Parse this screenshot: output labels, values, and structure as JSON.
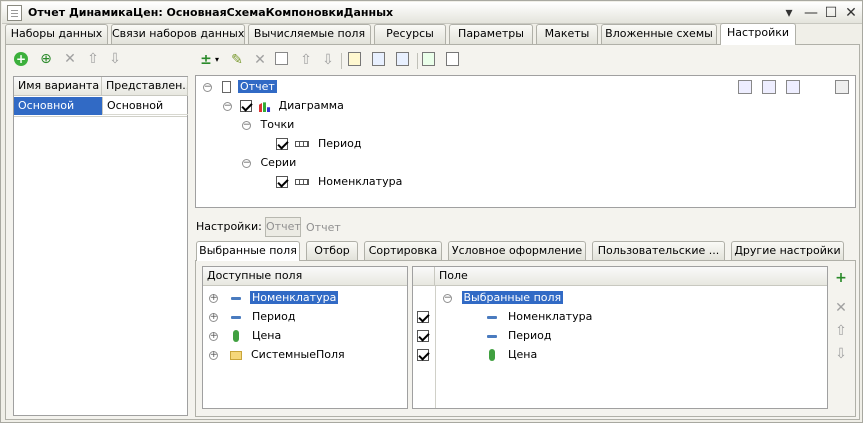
{
  "window": {
    "title": "Отчет ДинамикаЦен: ОсновнаяСхемаКомпоновкиДанных",
    "controls": {
      "menu": "▾",
      "minimize": "—",
      "maximize": "☐",
      "close": "✕"
    }
  },
  "tabs": [
    {
      "label": "Наборы данных"
    },
    {
      "label": "Связи наборов данных"
    },
    {
      "label": "Вычисляемые поля"
    },
    {
      "label": "Ресурсы"
    },
    {
      "label": "Параметры"
    },
    {
      "label": "Макеты"
    },
    {
      "label": "Вложенные схемы"
    },
    {
      "label": "Настройки"
    }
  ],
  "active_tab": "Настройки",
  "variants": {
    "columns": [
      "Имя варианта",
      "Представлен..."
    ],
    "rows": [
      {
        "name": "Основной",
        "presentation": "Основной"
      }
    ]
  },
  "structure_tree": {
    "root": "Отчет",
    "chart": "Диаграмма",
    "points": "Точки",
    "period": "Период",
    "series": "Серии",
    "nomenclature": "Номенклатура"
  },
  "settings_bar": {
    "label": "Настройки:",
    "button": "Отчет",
    "value": "Отчет"
  },
  "subtabs": [
    {
      "label": "Выбранные поля"
    },
    {
      "label": "Отбор"
    },
    {
      "label": "Сортировка"
    },
    {
      "label": "Условное оформление"
    },
    {
      "label": "Пользовательские ..."
    },
    {
      "label": "Другие настройки"
    }
  ],
  "available_fields": {
    "header": "Доступные поля",
    "items": [
      "Номенклатура",
      "Период",
      "Цена",
      "СистемныеПоля"
    ]
  },
  "selected_fields": {
    "header": "Поле",
    "group": "Выбранные поля",
    "items": [
      "Номенклатура",
      "Период",
      "Цена"
    ]
  },
  "icons": {
    "tb_add": "+",
    "tb_copy": "⊕",
    "tb_delete": "✕",
    "tb_up": "⇧",
    "tb_down": "⇩",
    "tb_edit": "✎",
    "tb_new_item": "±",
    "side_add": "+",
    "side_delete": "✕",
    "side_up": "⇧",
    "side_down": "⇩"
  }
}
